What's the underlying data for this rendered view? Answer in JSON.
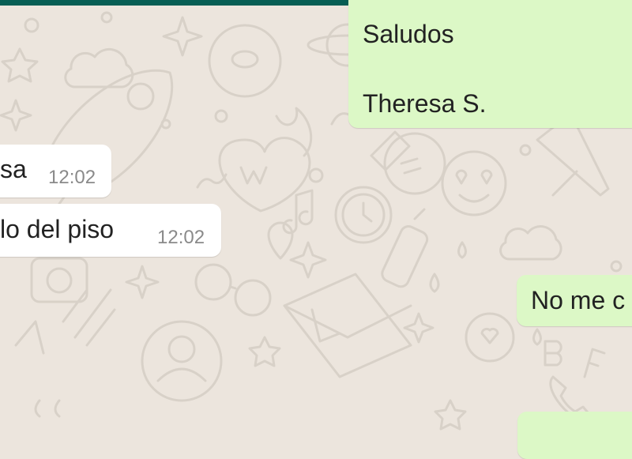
{
  "colors": {
    "header_bar": "#075e54",
    "chat_background": "#ece5dd",
    "outgoing_bubble": "#dcf8c6",
    "incoming_bubble": "#ffffff",
    "timestamp": "#8a8a8a"
  },
  "messages": [
    {
      "direction": "outgoing",
      "lines": [
        "Saludos",
        "Theresa S."
      ],
      "time": ""
    },
    {
      "direction": "incoming",
      "text": "sa",
      "time": "12:02"
    },
    {
      "direction": "incoming",
      "text": "lo del piso",
      "time": "12:02"
    },
    {
      "direction": "outgoing",
      "text": "No me c",
      "time": ""
    }
  ]
}
